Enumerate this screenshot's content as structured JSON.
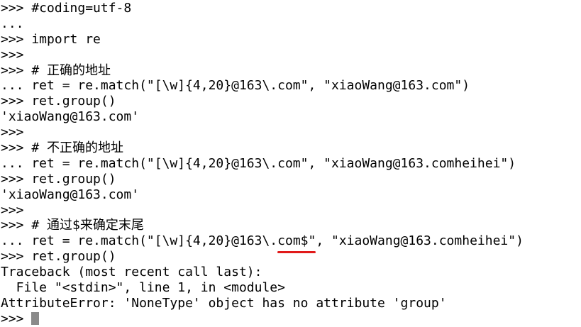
{
  "colors": {
    "background": "#ffffff",
    "text": "#000000",
    "cursor": "#8a8a8a",
    "annotation_underline": "#e11a1a"
  },
  "terminal": {
    "lines": [
      ">>> #coding=utf-8",
      "...",
      ">>> import re",
      ">>>",
      ">>> # 正确的地址",
      "... ret = re.match(\"[\\w]{4,20}@163\\.com\", \"xiaoWang@163.com\")",
      ">>> ret.group()",
      "'xiaoWang@163.com'",
      ">>>",
      ">>> # 不正确的地址",
      "... ret = re.match(\"[\\w]{4,20}@163\\.com\", \"xiaoWang@163.comheihei\")",
      ">>> ret.group()",
      "'xiaoWang@163.com'",
      ">>>",
      ">>> # 通过$来确定末尾"
    ],
    "highlight_line": {
      "before": "... ret = re.match(\"[\\w]{4,20}@163\\.",
      "highlight": "com$\"",
      "after": ", \"xiaoWang@163.comheihei\")"
    },
    "trailing_lines": [
      ">>> ret.group()",
      "Traceback (most recent call last):",
      "  File \"<stdin>\", line 1, in <module>",
      "AttributeError: 'NoneType' object has no attribute 'group'"
    ],
    "prompt": ">>> "
  }
}
